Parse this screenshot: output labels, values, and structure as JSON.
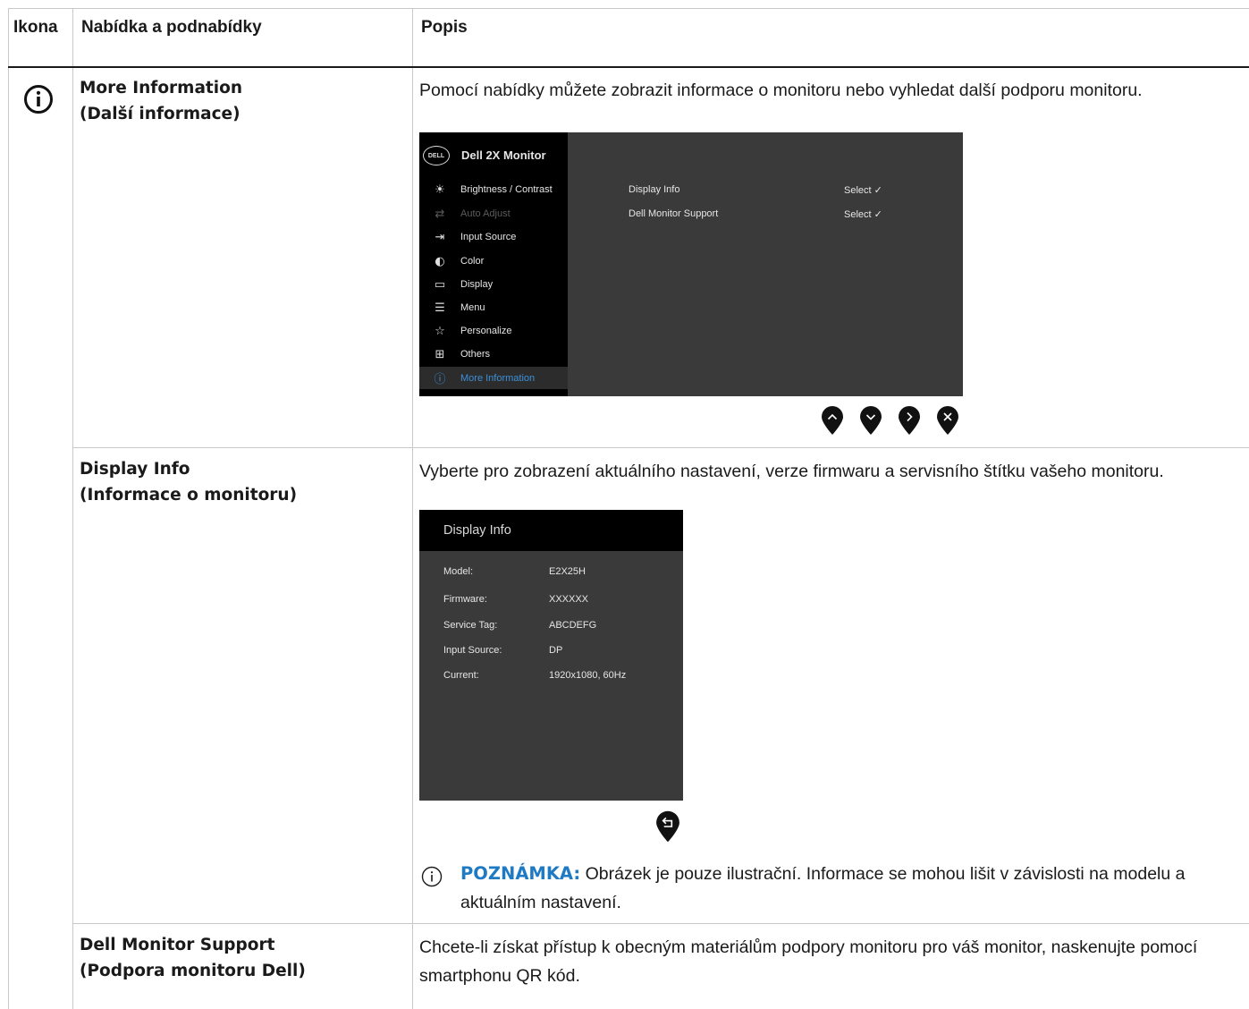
{
  "table": {
    "headers": {
      "icon": "Ikona",
      "menu": "Nabídka a podnabídky",
      "desc": "Popis"
    }
  },
  "section_icon": "info-circle-icon",
  "rows": {
    "more_info": {
      "title_en": "More Information",
      "title_cs": "(Další informace)",
      "desc": "Pomocí nabídky můžete zobrazit informace o monitoru nebo vyhledat další podporu monitoru."
    },
    "display_info": {
      "title_en": "Display Info",
      "title_cs": "(Informace o monitoru)",
      "desc": "Vyberte pro zobrazení aktuálního nastavení, verze firmwaru a servisního štítku vašeho monitoru."
    },
    "support": {
      "title_en": "Dell Monitor Support",
      "title_cs": "(Podpora monitoru Dell)",
      "desc": "Chcete-li získat přístup k obecným materiálům podpory monitoru pro váš monitor, naskenujte pomocí smartphonu QR kód."
    }
  },
  "osd": {
    "logo": "DELL",
    "title": "Dell 2X Monitor",
    "menu": [
      {
        "label": "Brightness / Contrast",
        "icon": "brightness-icon",
        "glyph": "☀"
      },
      {
        "label": "Auto Adjust",
        "icon": "auto-adjust-icon",
        "glyph": "⇄",
        "disabled": true
      },
      {
        "label": "Input Source",
        "icon": "input-source-icon",
        "glyph": "⇥"
      },
      {
        "label": "Color",
        "icon": "color-icon",
        "glyph": "◐"
      },
      {
        "label": "Display",
        "icon": "display-icon",
        "glyph": "▭"
      },
      {
        "label": "Menu",
        "icon": "menu-icon",
        "glyph": "☰"
      },
      {
        "label": "Personalize",
        "icon": "star-icon",
        "glyph": "☆"
      },
      {
        "label": "Others",
        "icon": "others-icon",
        "glyph": "⊞"
      },
      {
        "label": "More Information",
        "icon": "info-icon",
        "glyph": "ⓘ",
        "active": true
      }
    ],
    "submenu": [
      {
        "label": "Display Info",
        "value": "Select ✓"
      },
      {
        "label": "Dell Monitor Support",
        "value": "Select ✓"
      }
    ],
    "buttons": [
      "up-button",
      "down-button",
      "right-button",
      "close-button"
    ]
  },
  "display_info_panel": {
    "title": "Display Info",
    "rows": [
      {
        "key": "Model:",
        "value": "E2X25H"
      },
      {
        "key": "Firmware:",
        "value": "XXXXXX"
      },
      {
        "key": "Service Tag:",
        "value": "ABCDEFG"
      },
      {
        "key": "Input Source:",
        "value": "DP"
      },
      {
        "key": "Current:",
        "value": "1920x1080, 60Hz"
      }
    ],
    "back_button": "back-button"
  },
  "note": {
    "label": "POZNÁMKA:",
    "text": " Obrázek je pouze ilustrační. Informace se mohou lišit v závislosti na modelu a aktuálním nastavení."
  },
  "colors": {
    "note_label": "#1f7ac4",
    "osd_active": "#3d8fd8",
    "osd_bg": "#3a3a3a"
  }
}
